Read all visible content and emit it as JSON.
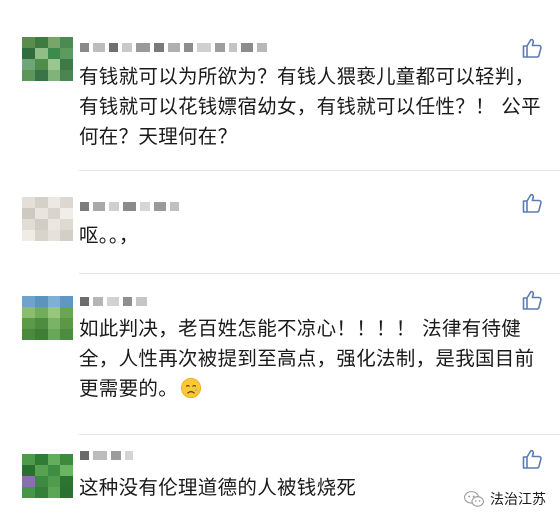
{
  "comments": [
    {
      "text": "有钱就可以为所欲为？有钱人猥亵儿童都可以轻判，有钱就可以花钱嫖宿幼女，有钱就可以任性？！ 公平何在？天理何在？"
    },
    {
      "text": "呕。。，"
    },
    {
      "text": "如此判决，老百姓怎能不凉心！！！！ 法律有待健全，人性再次被提到至高点，强化法制，是我国目前更需要的。"
    },
    {
      "text": "这种没有伦理道德的人被钱烧死"
    }
  ],
  "watermark": {
    "text": "法治江苏",
    "icon": "wechat-icon"
  },
  "icons": {
    "like": "thumbs-up-icon",
    "emoji": "sad-face-emoji"
  },
  "colors": {
    "like_icon": "#5b7bb4",
    "text": "#1a1a1a",
    "divider": "#e4e4e4"
  }
}
